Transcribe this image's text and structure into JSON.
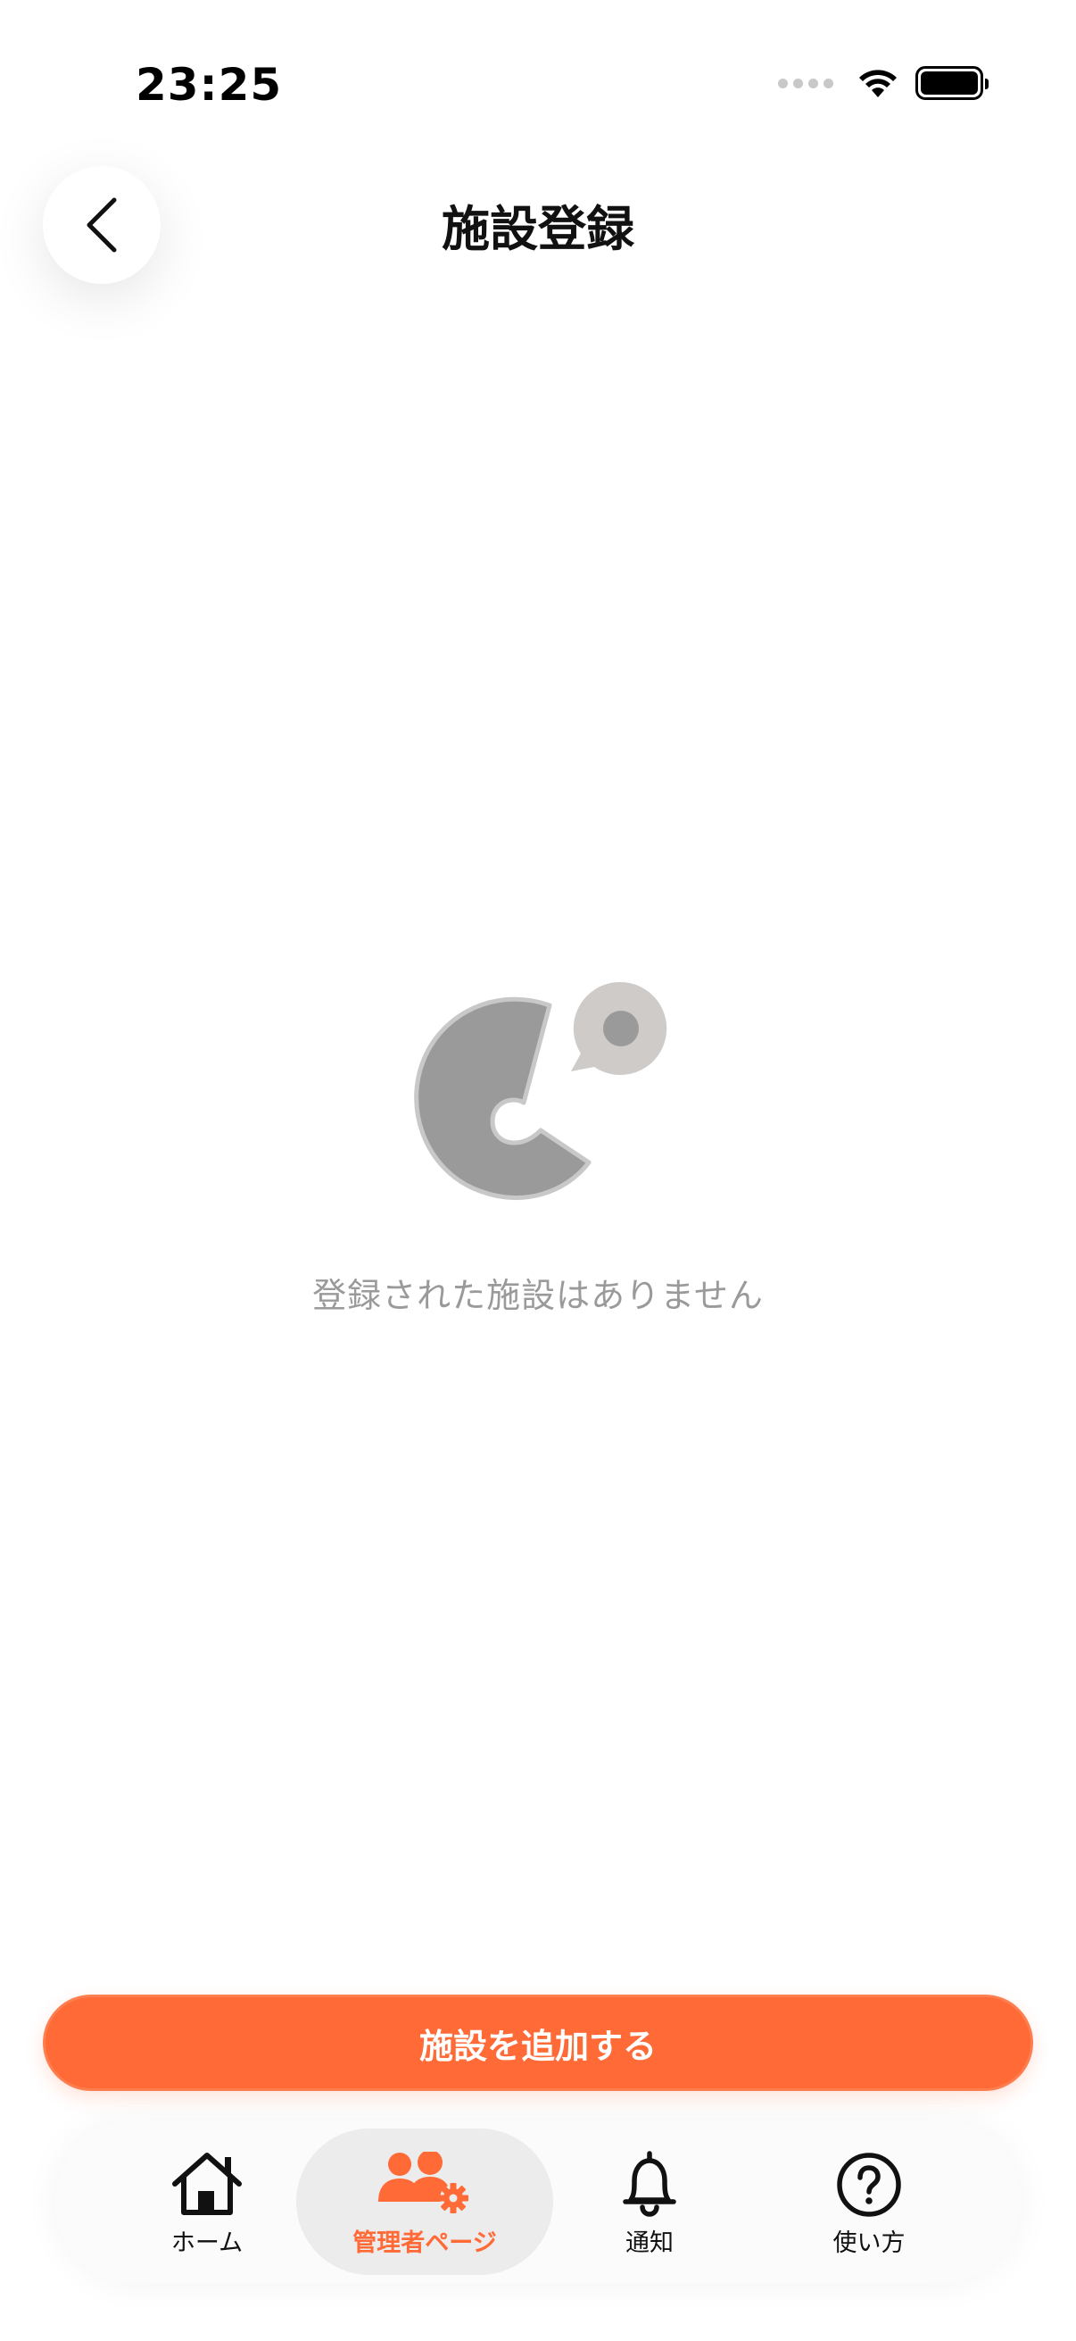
{
  "status_bar": {
    "time": "23:25"
  },
  "header": {
    "title": "施設登録",
    "back_icon": "chevron-left-icon"
  },
  "empty_state": {
    "icon": "app-logo-c-with-bubble",
    "message": "登録された施設はありません"
  },
  "actions": {
    "add_facility_label": "施設を追加する"
  },
  "tab_bar": {
    "items": [
      {
        "label": "ホーム",
        "icon": "home-icon",
        "active": false
      },
      {
        "label": "管理者ページ",
        "icon": "admin-users-gear-icon",
        "active": true
      },
      {
        "label": "通知",
        "icon": "bell-icon",
        "active": false
      },
      {
        "label": "使い方",
        "icon": "help-circle-icon",
        "active": false
      }
    ]
  },
  "colors": {
    "accent": "#ff6a36",
    "text_primary": "#111111",
    "text_muted": "#9a9a9a",
    "tab_active_bg": "#ececec",
    "illustration_gray": "#9a9a9a",
    "illustration_light": "#cfcbc8"
  }
}
